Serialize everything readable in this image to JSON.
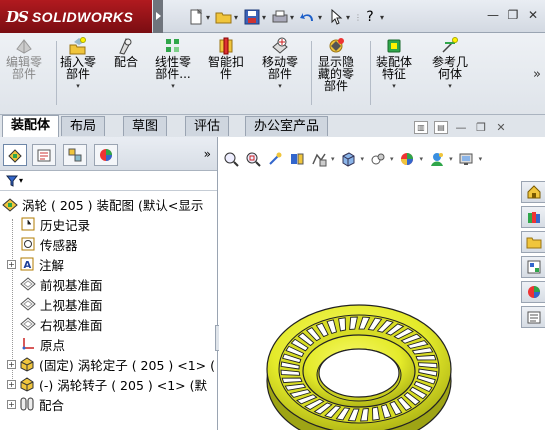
{
  "app": {
    "brand": "SOLIDWORKS",
    "brand_prefix": "DS"
  },
  "titlebar": {
    "quick_access": [
      "new-icon",
      "open-icon",
      "save-icon",
      "print-icon",
      "undo-icon",
      "select-icon",
      "rebuild-icon"
    ],
    "help_label": "?",
    "window_buttons": [
      "minimize",
      "restore",
      "close"
    ]
  },
  "ribbon": {
    "tools": [
      {
        "label": "编辑零\n部件",
        "enabled": false,
        "icon": "edit-component-icon"
      },
      {
        "label": "插入零\n部件",
        "enabled": true,
        "icon": "insert-component-icon"
      },
      {
        "label": "配合",
        "enabled": true,
        "icon": "mate-icon"
      },
      {
        "label": "线性零\n部件...",
        "enabled": true,
        "icon": "linear-pattern-icon"
      },
      {
        "label": "智能扣\n件",
        "enabled": true,
        "icon": "smart-fastener-icon"
      },
      {
        "label": "移动零\n部件",
        "enabled": true,
        "icon": "move-component-icon"
      },
      {
        "label": "显示隐\n藏的零\n部件",
        "enabled": true,
        "icon": "show-hidden-icon"
      },
      {
        "label": "装配体\n特征",
        "enabled": true,
        "icon": "assembly-feature-icon"
      },
      {
        "label": "参考几\n何体",
        "enabled": true,
        "icon": "reference-geometry-icon"
      }
    ],
    "more": "»"
  },
  "command_tabs": [
    {
      "label": "装配体",
      "active": true
    },
    {
      "label": "布局",
      "active": false
    },
    {
      "label": "草图",
      "active": false
    },
    {
      "label": "评估",
      "active": false
    },
    {
      "label": "办公室产品",
      "active": false
    }
  ],
  "feature_manager": {
    "tabs": [
      "feature-manager-icon",
      "property-manager-icon",
      "configuration-manager-icon",
      "display-manager-icon"
    ],
    "more": "»",
    "tree": [
      {
        "label": "涡轮 ( 205 ) 装配图  (默认<显示",
        "icon": "assembly-icon",
        "expand": "",
        "level": 0
      },
      {
        "label": "历史记录",
        "icon": "history-icon",
        "expand": "",
        "level": 1
      },
      {
        "label": "传感器",
        "icon": "sensor-icon",
        "expand": "",
        "level": 1
      },
      {
        "label": "注解",
        "icon": "annotation-icon",
        "expand": "+",
        "level": 1
      },
      {
        "label": "前视基准面",
        "icon": "plane-icon",
        "expand": "",
        "level": 1
      },
      {
        "label": "上视基准面",
        "icon": "plane-icon",
        "expand": "",
        "level": 1
      },
      {
        "label": "右视基准面",
        "icon": "plane-icon",
        "expand": "",
        "level": 1
      },
      {
        "label": "原点",
        "icon": "origin-icon",
        "expand": "",
        "level": 1
      },
      {
        "label": "(固定) 涡轮定子 ( 205 ) <1> (",
        "icon": "part-icon",
        "expand": "+",
        "level": 1
      },
      {
        "label": "(-) 涡轮转子 ( 205 ) <1> (默",
        "icon": "part-icon",
        "expand": "+",
        "level": 1
      },
      {
        "label": "配合",
        "icon": "mates-folder-icon",
        "expand": "+",
        "level": 1
      }
    ]
  },
  "graphics": {
    "heads_up_toolbar": [
      "zoom-to-fit-icon",
      "zoom-area-icon",
      "previous-view-icon",
      "section-view-icon",
      "dynamic-annotation-icon",
      "view-orientation-icon",
      "display-style-icon",
      "hide-show-icon",
      "edit-appearance-icon",
      "apply-scene-icon",
      "view-settings-icon"
    ],
    "task_pane": [
      "home-icon",
      "design-library-icon",
      "file-explorer-icon",
      "view-palette-icon",
      "appearances-icon",
      "custom-properties-icon"
    ],
    "model_color": "#e4ea2a"
  }
}
